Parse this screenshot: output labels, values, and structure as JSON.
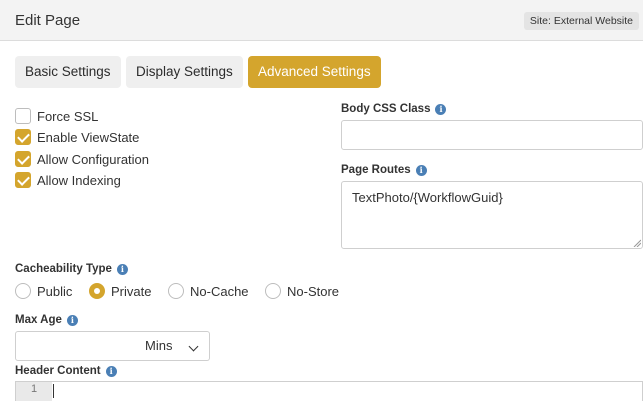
{
  "header": {
    "title": "Edit Page",
    "site_badge": "Site: External Website"
  },
  "tabs": [
    {
      "label": "Basic Settings",
      "active": false
    },
    {
      "label": "Display Settings",
      "active": false
    },
    {
      "label": "Advanced Settings",
      "active": true
    }
  ],
  "checkboxes": [
    {
      "label": "Force SSL",
      "checked": false
    },
    {
      "label": "Enable ViewState",
      "checked": true
    },
    {
      "label": "Allow Configuration",
      "checked": true
    },
    {
      "label": "Allow Indexing",
      "checked": true
    }
  ],
  "body_css_class": {
    "label": "Body CSS Class",
    "value": "",
    "icon": "info-icon"
  },
  "page_routes": {
    "label": "Page Routes",
    "value": "TextPhoto/{WorkflowGuid}",
    "icon": "info-icon"
  },
  "cacheability": {
    "label": "Cacheability Type",
    "options": [
      {
        "label": "Public",
        "selected": false
      },
      {
        "label": "Private",
        "selected": true
      },
      {
        "label": "No-Cache",
        "selected": false
      },
      {
        "label": "No-Store",
        "selected": false
      }
    ]
  },
  "max_age": {
    "label": "Max Age",
    "value": "",
    "unit": "Mins"
  },
  "header_content": {
    "label": "Header Content",
    "line_number": "1"
  },
  "colors": {
    "accent": "#d4a52d",
    "info": "#4a7fb5"
  }
}
